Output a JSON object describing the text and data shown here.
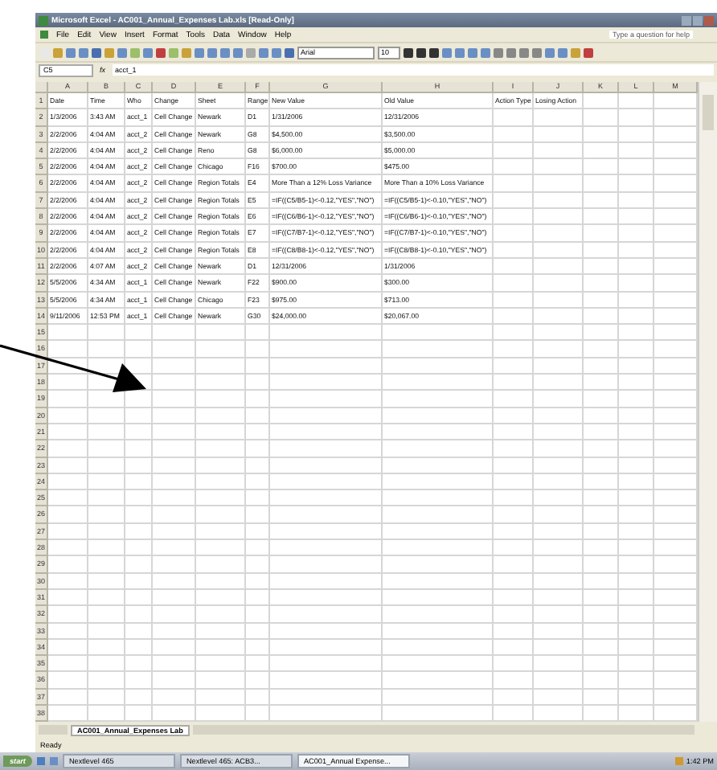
{
  "window": {
    "title": "Microsoft Excel - AC001_Annual_Expenses Lab.xls [Read-Only]"
  },
  "menu": [
    "File",
    "Edit",
    "View",
    "Insert",
    "Format",
    "Tools",
    "Data",
    "Window",
    "Help"
  ],
  "help_box": {
    "placeholder": "Type a question for help"
  },
  "toolbar": {
    "font": "Arial",
    "size": "10"
  },
  "formula_bar": {
    "name_box": "C5",
    "fx": "fx",
    "value": "acct_1"
  },
  "columns": [
    "A",
    "B",
    "C",
    "D",
    "E",
    "F",
    "G",
    "H",
    "I",
    "J",
    "K",
    "L",
    "M"
  ],
  "rows": [
    {
      "number": "1",
      "cells": [
        "Date",
        "Time",
        "Who",
        "Change",
        "Sheet",
        "Range",
        "New Value",
        "Old Value",
        "Action Type",
        "Losing Action"
      ]
    },
    {
      "number": "2",
      "cells": [
        "1/3/2006",
        "3:43 AM",
        "acct_1",
        "Cell Change",
        "Newark",
        "D1",
        "1/31/2006",
        "12/31/2006"
      ]
    },
    {
      "number": "3",
      "cells": [
        "2/2/2006",
        "4:04 AM",
        "acct_2",
        "Cell Change",
        "Newark",
        "G8",
        "$4,500.00",
        "$3,500.00"
      ]
    },
    {
      "number": "4",
      "cells": [
        "2/2/2006",
        "4:04 AM",
        "acct_2",
        "Cell Change",
        "Reno",
        "G8",
        "$6,000.00",
        "$5,000.00"
      ]
    },
    {
      "number": "5",
      "cells": [
        "2/2/2006",
        "4:04 AM",
        "acct_2",
        "Cell Change",
        "Chicago",
        "F16",
        "$700.00",
        "$475.00"
      ]
    },
    {
      "number": "6",
      "cells": [
        "2/2/2006",
        "4:04 AM",
        "acct_2",
        "Cell Change",
        "Region Totals",
        "E4",
        "More Than a 12% Loss Variance",
        "More Than a 10% Loss Variance"
      ]
    },
    {
      "number": "7",
      "cells": [
        "2/2/2006",
        "4:04 AM",
        "acct_2",
        "Cell Change",
        "Region Totals",
        "E5",
        "=IF((C5/B5-1)<-0.12,\"YES\",\"NO\")",
        "=IF((C5/B5-1)<-0.10,\"YES\",\"NO\")"
      ]
    },
    {
      "number": "8",
      "cells": [
        "2/2/2006",
        "4:04 AM",
        "acct_2",
        "Cell Change",
        "Region Totals",
        "E6",
        "=IF((C6/B6-1)<-0.12,\"YES\",\"NO\")",
        "=IF((C6/B6-1)<-0.10,\"YES\",\"NO\")"
      ]
    },
    {
      "number": "9",
      "cells": [
        "2/2/2006",
        "4:04 AM",
        "acct_2",
        "Cell Change",
        "Region Totals",
        "E7",
        "=IF((C7/B7-1)<-0.12,\"YES\",\"NO\")",
        "=IF((C7/B7-1)<-0.10,\"YES\",\"NO\")"
      ]
    },
    {
      "number": "10",
      "cells": [
        "2/2/2006",
        "4:04 AM",
        "acct_2",
        "Cell Change",
        "Region Totals",
        "E8",
        "=IF((C8/B8-1)<-0.12,\"YES\",\"NO\")",
        "=IF((C8/B8-1)<-0.10,\"YES\",\"NO\")"
      ]
    },
    {
      "number": "11",
      "cells": [
        "2/2/2006",
        "4:07 AM",
        "acct_2",
        "Cell Change",
        "Newark",
        "D1",
        "12/31/2006",
        "1/31/2006"
      ]
    },
    {
      "number": "12",
      "cells": [
        "5/5/2006",
        "4:34 AM",
        "acct_1",
        "Cell Change",
        "Newark",
        "F22",
        "$900.00",
        "$300.00"
      ]
    },
    {
      "number": "13",
      "cells": [
        "5/5/2006",
        "4:34 AM",
        "acct_1",
        "Cell Change",
        "Chicago",
        "F23",
        "$975.00",
        "$713.00"
      ]
    },
    {
      "number": "14",
      "cells": [
        "9/11/2006",
        "12:53 PM",
        "acct_1",
        "Cell Change",
        "Newark",
        "G30",
        "$24,000.00",
        "$20,067.00"
      ]
    },
    {
      "number": "15"
    },
    {
      "number": "16"
    },
    {
      "number": "17"
    },
    {
      "number": "18"
    },
    {
      "number": "19"
    },
    {
      "number": "20"
    },
    {
      "number": "21"
    },
    {
      "number": "22"
    },
    {
      "number": "23"
    },
    {
      "number": "24"
    },
    {
      "number": "25"
    },
    {
      "number": "26"
    },
    {
      "number": "27"
    },
    {
      "number": "28"
    },
    {
      "number": "29"
    },
    {
      "number": "30"
    },
    {
      "number": "31"
    },
    {
      "number": "32"
    },
    {
      "number": "33"
    },
    {
      "number": "34"
    },
    {
      "number": "35"
    },
    {
      "number": "36"
    },
    {
      "number": "37"
    },
    {
      "number": "38"
    }
  ],
  "sheet_tabs": [
    {
      "label": "AC001_Annual_Expenses Lab",
      "selected": true
    }
  ],
  "status_bar": "Ready",
  "taskbar": {
    "start": "start",
    "tasks": [
      {
        "label": "Nextlevel 465",
        "selected": false
      },
      {
        "label": "Nextlevel 465: ACB3...",
        "selected": false
      },
      {
        "label": "AC001_Annual Expense...",
        "selected": true
      }
    ],
    "clock": "1:42 PM"
  }
}
